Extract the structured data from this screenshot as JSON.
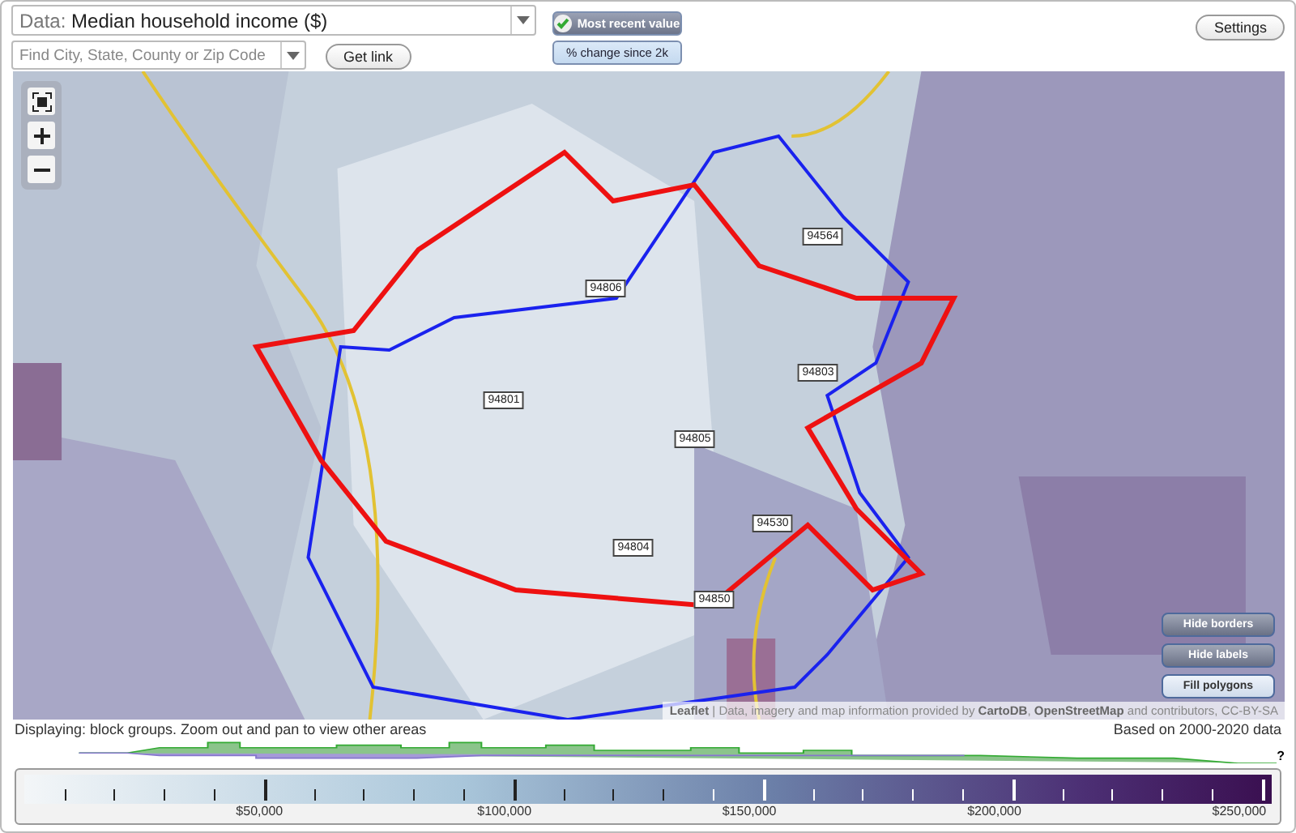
{
  "data_select": {
    "label": "Data:",
    "value": "Median household income ($)"
  },
  "search": {
    "placeholder": "Find City, State, County or Zip Code"
  },
  "get_link": "Get link",
  "modes": [
    {
      "label": "Most recent value",
      "selected": true
    },
    {
      "label": "% change since 2k",
      "selected": false
    }
  ],
  "settings": "Settings",
  "map": {
    "zip_labels": [
      "94564",
      "94806",
      "94801",
      "94803",
      "94805",
      "94530",
      "94804",
      "94850"
    ],
    "buttons": [
      {
        "label": "Hide borders",
        "on": true
      },
      {
        "label": "Hide labels",
        "on": true
      },
      {
        "label": "Fill polygons",
        "on": false
      }
    ],
    "attribution": "**Leaflet** | Data, imagery and map information provided by **CartoDB**, **OpenStreetMap** and contributors, CC-BY-SA"
  },
  "status": {
    "left": "Displaying: block groups. Zoom out and pan to view other areas",
    "right": "Based on 2000-2020 data"
  },
  "histogram_note": "?",
  "legend": {
    "ticks": [
      "$50,000",
      "$100,000",
      "$150,000",
      "$200,000",
      "$250,000"
    ]
  }
}
